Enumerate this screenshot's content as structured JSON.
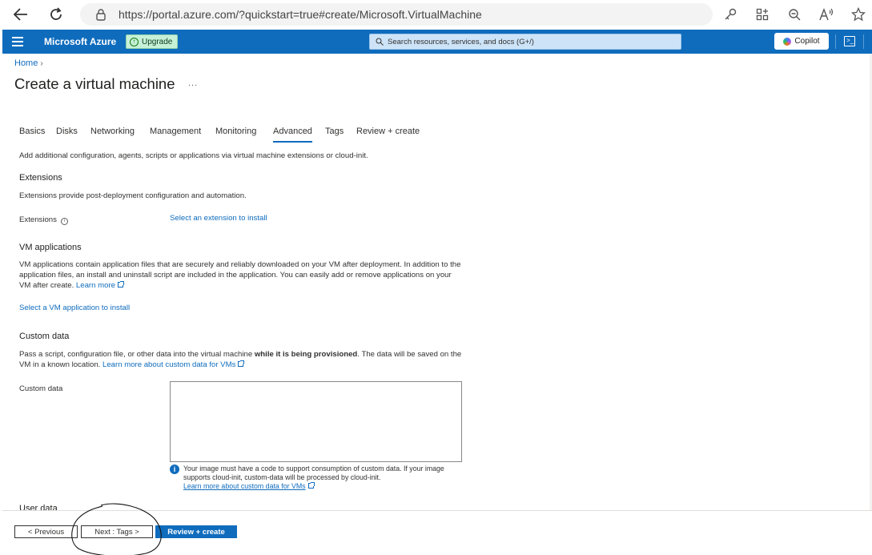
{
  "browser": {
    "url": "https://portal.azure.com/?quickstart=true#create/Microsoft.VirtualMachine"
  },
  "header": {
    "brand": "Microsoft Azure",
    "upgrade_label": "Upgrade",
    "search_placeholder": "Search resources, services, and docs (G+/)",
    "copilot_label": "Copilot"
  },
  "breadcrumb": {
    "home": "Home"
  },
  "page": {
    "title": "Create a virtual machine",
    "more": "..."
  },
  "tabs": [
    {
      "label": "Basics"
    },
    {
      "label": "Disks"
    },
    {
      "label": "Networking"
    },
    {
      "label": "Management"
    },
    {
      "label": "Monitoring"
    },
    {
      "label": "Advanced"
    },
    {
      "label": "Tags"
    },
    {
      "label": "Review + create"
    }
  ],
  "active_tab": "Advanced",
  "intro": "Add additional configuration, agents, scripts or applications via virtual machine extensions or cloud-init.",
  "extensions": {
    "heading": "Extensions",
    "description": "Extensions provide post-deployment configuration and automation.",
    "field_label": "Extensions",
    "select_link": "Select an extension to install"
  },
  "vm_applications": {
    "heading": "VM applications",
    "description": "VM applications contain application files that are securely and reliably downloaded on your VM after deployment. In addition to the application files, an install and uninstall script are included in the application. You can easily add or remove applications on your VM after create.",
    "learn_more": "Learn more",
    "select_link": "Select a VM application to install"
  },
  "custom_data": {
    "heading": "Custom data",
    "description_pre": "Pass a script, configuration file, or other data into the virtual machine ",
    "description_bold": "while it is being provisioned",
    "description_post": ". The data will be saved on the VM in a known location.",
    "learn_more": "Learn more about custom data for VMs",
    "field_label": "Custom data",
    "value": "",
    "note": "Your image must have a code to support consumption of custom data. If your image supports cloud-init, custom-data will be processed by cloud-init.",
    "note_link": "Learn more about custom data for VMs"
  },
  "next_section_heading": "User data",
  "footer": {
    "previous": "< Previous",
    "next": "Next : Tags >",
    "review": "Review + create"
  },
  "colors": {
    "azure_blue": "#0f6cbd",
    "text": "#323130",
    "upgrade_bg": "#c7f0d8"
  }
}
